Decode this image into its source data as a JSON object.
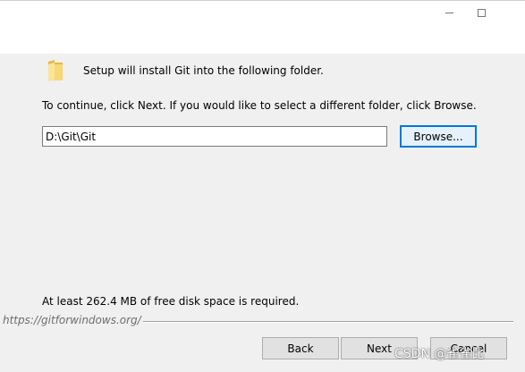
{
  "window": {
    "minimize_icon": "minimize-icon",
    "maximize_icon": "maximize-icon"
  },
  "content": {
    "heading": "Setup will install Git into the following folder.",
    "folder_icon": "folder-icon",
    "instructions": "To continue, click Next. If you would like to select a different folder, click Browse.",
    "path_value": "D:\\Git\\Git",
    "browse_label": "Browse...",
    "space_note": "At least 262.4 MB of free disk space is required."
  },
  "footer": {
    "url": "https://gitforwindows.org/",
    "back_label": "Back",
    "next_label": "Next",
    "cancel_label": "Cancel"
  },
  "watermark": "CSDN @雀雀比",
  "colors": {
    "accent": "#0078d7",
    "background": "#f0f0f0",
    "titlebar": "#ffffff"
  }
}
